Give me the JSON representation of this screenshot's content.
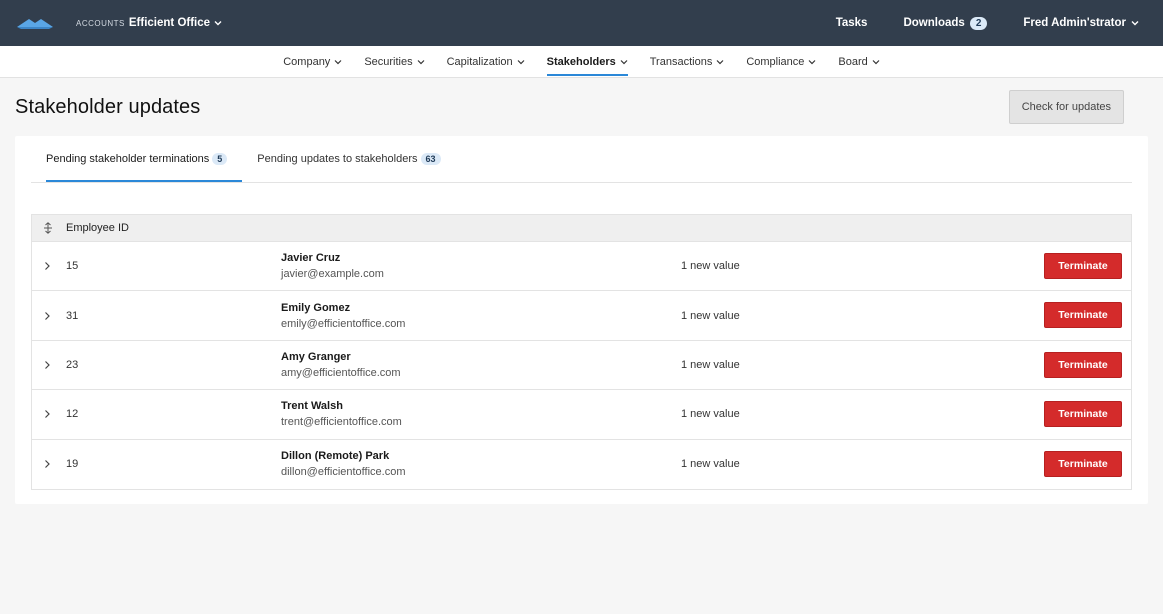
{
  "topbar": {
    "logo_icon": "cloud-logo-icon",
    "account_label": "ACCOUNTS",
    "account_name": "Efficient Office",
    "tasks_label": "Tasks",
    "downloads_label": "Downloads",
    "downloads_count": "2",
    "user_name": "Fred Admin'strator"
  },
  "subnav": {
    "items": [
      {
        "label": "Company"
      },
      {
        "label": "Securities"
      },
      {
        "label": "Capitalization"
      },
      {
        "label": "Stakeholders"
      },
      {
        "label": "Transactions"
      },
      {
        "label": "Compliance"
      },
      {
        "label": "Board"
      }
    ],
    "active_index": 3
  },
  "header": {
    "title": "Stakeholder updates",
    "check_button": "Check for updates"
  },
  "tabs": [
    {
      "label": "Pending stakeholder terminations",
      "count": "5"
    },
    {
      "label": "Pending updates to stakeholders",
      "count": "63"
    }
  ],
  "table": {
    "column_header": "Employee ID",
    "rows": [
      {
        "id": "15",
        "name": "Javier Cruz",
        "email": "javier@example.com",
        "changes": "1 new value",
        "action": "Terminate"
      },
      {
        "id": "31",
        "name": "Emily Gomez",
        "email": "emily@efficientoffice.com",
        "changes": "1 new value",
        "action": "Terminate"
      },
      {
        "id": "23",
        "name": "Amy Granger",
        "email": "amy@efficientoffice.com",
        "changes": "1 new value",
        "action": "Terminate"
      },
      {
        "id": "12",
        "name": "Trent Walsh",
        "email": "trent@efficientoffice.com",
        "changes": "1 new value",
        "action": "Terminate"
      },
      {
        "id": "19",
        "name": "Dillon (Remote) Park",
        "email": "dillon@efficientoffice.com",
        "changes": "1 new value",
        "action": "Terminate"
      }
    ]
  },
  "colors": {
    "topbar_bg": "#323e4d",
    "accent": "#2b88d8",
    "danger": "#d42b2b"
  }
}
